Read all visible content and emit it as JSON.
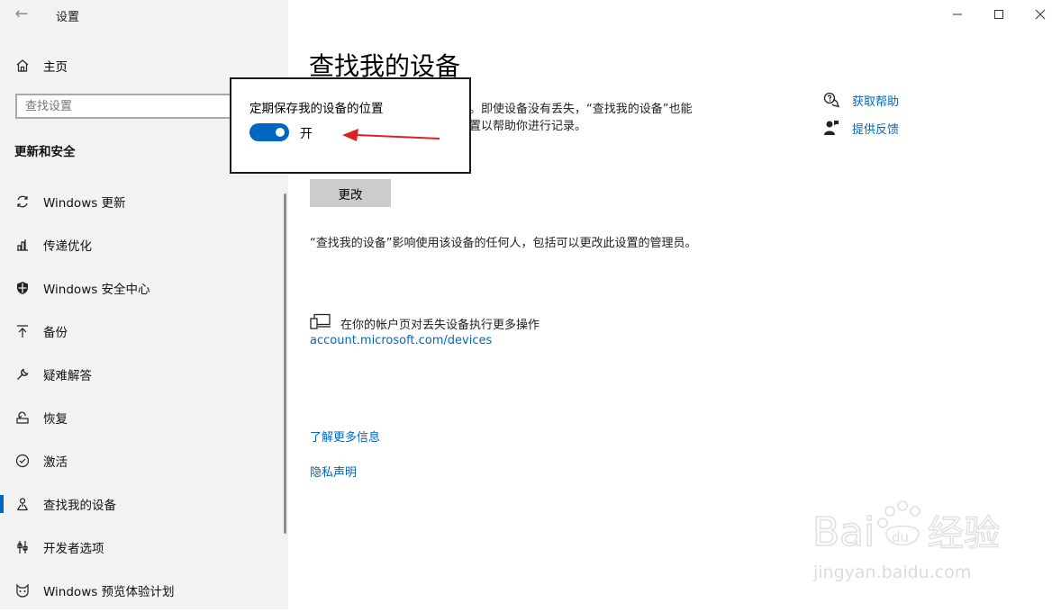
{
  "window": {
    "title": "设置",
    "controls": {
      "minimize": "—",
      "maximize": "☐",
      "close": "✕"
    }
  },
  "sidebar": {
    "home_label": "主页",
    "search_placeholder": "查找设置",
    "section_title": "更新和安全",
    "items": [
      {
        "label": "Windows 更新",
        "icon": "refresh-icon"
      },
      {
        "label": "传递优化",
        "icon": "delivery-optimization-icon"
      },
      {
        "label": "Windows 安全中心",
        "icon": "shield-icon"
      },
      {
        "label": "备份",
        "icon": "backup-arrow-icon"
      },
      {
        "label": "疑难解答",
        "icon": "wrench-icon"
      },
      {
        "label": "恢复",
        "icon": "recovery-icon"
      },
      {
        "label": "激活",
        "icon": "check-circle-icon"
      },
      {
        "label": "查找我的设备",
        "icon": "find-device-icon",
        "active": true
      },
      {
        "label": "开发者选项",
        "icon": "developer-icon"
      },
      {
        "label": "Windows 预览体验计划",
        "icon": "insider-cat-icon"
      }
    ]
  },
  "main": {
    "title": "查找我的设备",
    "description_line1": "。即使设备没有丢失，“查找我的设备”也能",
    "description_line2": "置以帮助你进行记录。",
    "change_button": "更改",
    "affect_text": "“查找我的设备”影响使用该设备的任何人，包括可以更改此设置的管理员。",
    "account_label": "在你的帐户页对丢失设备执行更多操作",
    "account_link": "account.microsoft.com/devices",
    "learn_more": "了解更多信息",
    "privacy": "隐私声明"
  },
  "right_panel": {
    "help": "获取帮助",
    "feedback": "提供反馈"
  },
  "popup": {
    "title": "定期保存我的设备的位置",
    "toggle_state": "开",
    "toggle_on": true
  },
  "watermark": {
    "brand": "Bai经验",
    "url": "jingyan.baidu.com"
  },
  "colors": {
    "accent": "#0067c0",
    "arrow": "#e02020",
    "sidebar_bg": "#f2f2f2"
  }
}
